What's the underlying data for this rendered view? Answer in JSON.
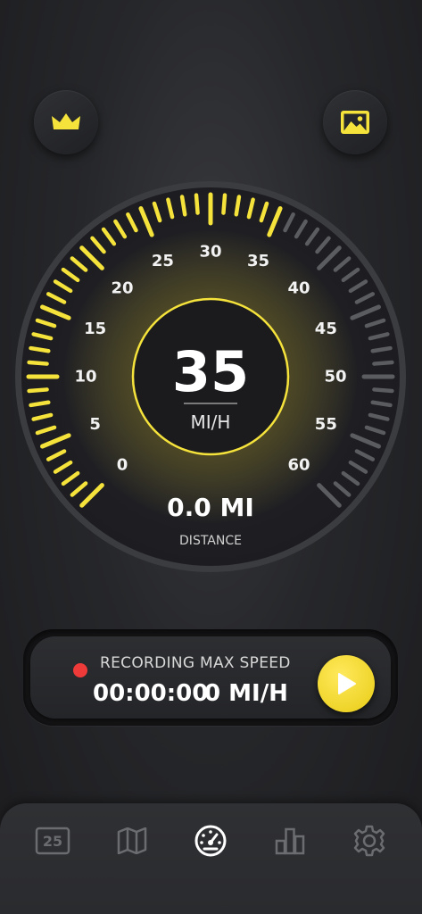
{
  "header": {
    "premium_icon": "crown-icon",
    "wallpaper_icon": "image-icon",
    "accent_color": "#f5e33c"
  },
  "gauge": {
    "scale_labels": [
      "0",
      "5",
      "10",
      "15",
      "20",
      "25",
      "30",
      "35",
      "40",
      "45",
      "50",
      "55",
      "60"
    ],
    "scale_max": 60,
    "speed_limit_marker": 35,
    "speed": "35",
    "speed_unit": "MI/H",
    "distance_value": "0.0 MI",
    "distance_label": "DISTANCE"
  },
  "recording": {
    "recording_label": "RECORDING",
    "time_value": "00:00:00",
    "max_speed_label": "MAX SPEED",
    "max_speed_value": "0 MI/H",
    "status_color": "#ef3a3a"
  },
  "tabs": [
    {
      "name": "calendar",
      "icon": "calendar-icon",
      "text": "25"
    },
    {
      "name": "map",
      "icon": "map-icon"
    },
    {
      "name": "speedometer",
      "icon": "speedometer-icon",
      "active": true
    },
    {
      "name": "stats",
      "icon": "bar-chart-icon"
    },
    {
      "name": "settings",
      "icon": "gear-icon"
    }
  ]
}
